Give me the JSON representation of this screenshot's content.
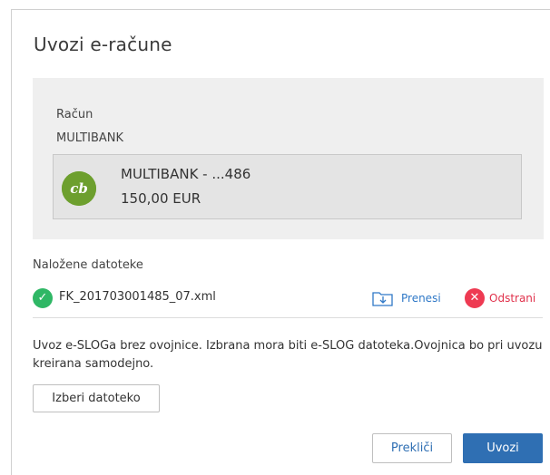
{
  "dialog": {
    "title": "Uvozi e-račune"
  },
  "account": {
    "label": "Račun",
    "bank": "MULTIBANK",
    "card": {
      "logo_text": "cb",
      "name": "MULTIBANK - ...486",
      "amount": "150,00 EUR"
    }
  },
  "files": {
    "label": "Naložene datoteke",
    "items": [
      {
        "name": "FK_201703001485_07.xml",
        "status_icon": "check-circle-icon",
        "download_label": "Prenesi",
        "remove_label": "Odstrani"
      }
    ]
  },
  "info": "Uvoz e-SLOGa brez ovojnice. Izbrana mora biti e-SLOG datoteka.Ovojnica bo pri uvozu kreirana samodejno.",
  "actions": {
    "choose_file": "Izberi datoteko",
    "cancel": "Prekliči",
    "import": "Uvozi"
  },
  "colors": {
    "accent": "#2f6fb3",
    "success": "#2fb765",
    "danger": "#ee3a52",
    "logo": "#6d9f2e",
    "panel": "#efefef"
  }
}
